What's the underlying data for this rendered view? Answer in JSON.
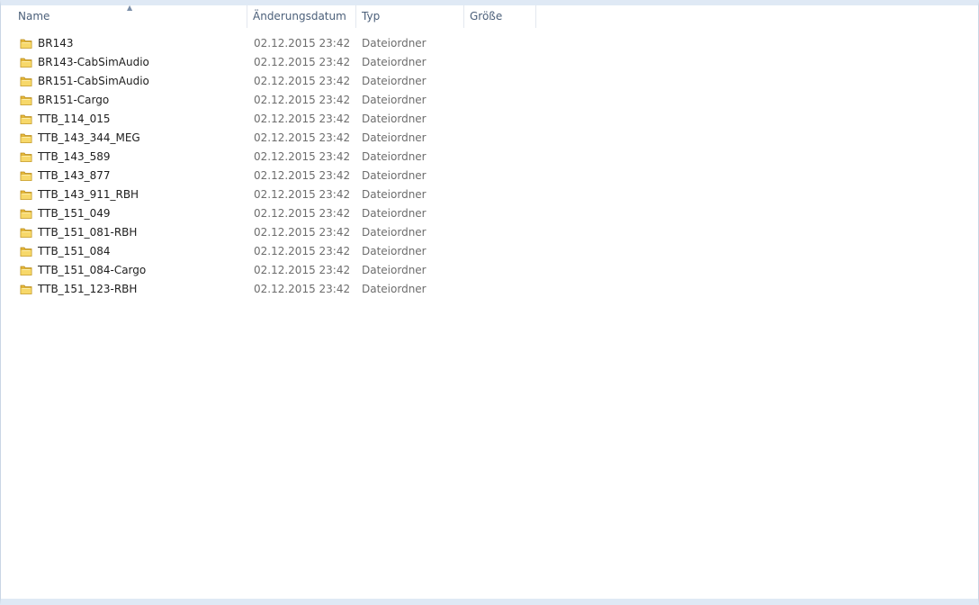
{
  "columns": {
    "name": "Name",
    "date": "Änderungsdatum",
    "type": "Typ",
    "size": "Größe"
  },
  "sort": {
    "column": "name",
    "direction": "ascending",
    "icon": "sort-ascending-arrow"
  },
  "icon_folder": "folder-icon",
  "files": [
    {
      "name": "BR143",
      "date": "02.12.2015 23:42",
      "type": "Dateiordner",
      "size": ""
    },
    {
      "name": "BR143-CabSimAudio",
      "date": "02.12.2015 23:42",
      "type": "Dateiordner",
      "size": ""
    },
    {
      "name": "BR151-CabSimAudio",
      "date": "02.12.2015 23:42",
      "type": "Dateiordner",
      "size": ""
    },
    {
      "name": "BR151-Cargo",
      "date": "02.12.2015 23:42",
      "type": "Dateiordner",
      "size": ""
    },
    {
      "name": "TTB_114_015",
      "date": "02.12.2015 23:42",
      "type": "Dateiordner",
      "size": ""
    },
    {
      "name": "TTB_143_344_MEG",
      "date": "02.12.2015 23:42",
      "type": "Dateiordner",
      "size": ""
    },
    {
      "name": "TTB_143_589",
      "date": "02.12.2015 23:42",
      "type": "Dateiordner",
      "size": ""
    },
    {
      "name": "TTB_143_877",
      "date": "02.12.2015 23:42",
      "type": "Dateiordner",
      "size": ""
    },
    {
      "name": "TTB_143_911_RBH",
      "date": "02.12.2015 23:42",
      "type": "Dateiordner",
      "size": ""
    },
    {
      "name": "TTB_151_049",
      "date": "02.12.2015 23:42",
      "type": "Dateiordner",
      "size": ""
    },
    {
      "name": "TTB_151_081-RBH",
      "date": "02.12.2015 23:42",
      "type": "Dateiordner",
      "size": ""
    },
    {
      "name": "TTB_151_084",
      "date": "02.12.2015 23:42",
      "type": "Dateiordner",
      "size": ""
    },
    {
      "name": "TTB_151_084-Cargo",
      "date": "02.12.2015 23:42",
      "type": "Dateiordner",
      "size": ""
    },
    {
      "name": "TTB_151_123-RBH",
      "date": "02.12.2015 23:42",
      "type": "Dateiordner",
      "size": ""
    }
  ]
}
